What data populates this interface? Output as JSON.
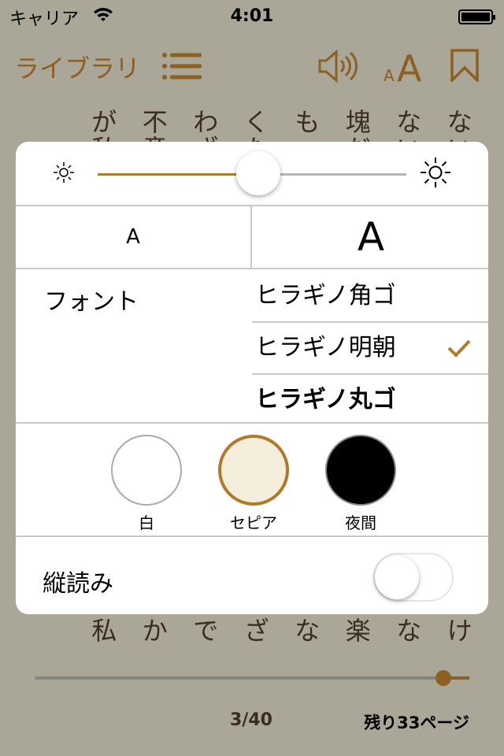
{
  "status": {
    "carrier": "キャリア",
    "time": "4:01"
  },
  "nav": {
    "library_label": "ライブラリ",
    "icons": [
      "list-icon",
      "speaker-icon",
      "font-size-icon",
      "bookmark-icon"
    ],
    "accent": "#8c5f22"
  },
  "book": {
    "row1": [
      "が",
      "不",
      "わ",
      "く",
      "も",
      "塊",
      "な",
      "な"
    ],
    "row2": [
      "私",
      "意",
      "ざ",
      "た",
      "、",
      "だ",
      "い",
      "い"
    ],
    "row_bottom": [
      "私",
      "か",
      "で",
      "ざ",
      "な",
      "楽",
      "な",
      "け"
    ]
  },
  "settings": {
    "brightness": 0.52,
    "small_a": "A",
    "large_a": "A",
    "font_label": "フォント",
    "fonts": [
      {
        "name": "ヒラギノ角ゴ",
        "selected": false
      },
      {
        "name": "ヒラギノ明朝",
        "selected": true
      },
      {
        "name": "ヒラギノ丸ゴ",
        "selected": false
      }
    ],
    "themes": [
      {
        "label": "白",
        "color": "#ffffff",
        "selected": false
      },
      {
        "label": "セピア",
        "color": "#f6eedd",
        "selected": true
      },
      {
        "label": "夜間",
        "color": "#000000",
        "selected": false
      }
    ],
    "vertical_label": "縦読み",
    "vertical_on": false,
    "accent": "#b07a2a"
  },
  "footer": {
    "page": "3/40",
    "remaining": "残り33ページ",
    "progress": 0.94
  }
}
